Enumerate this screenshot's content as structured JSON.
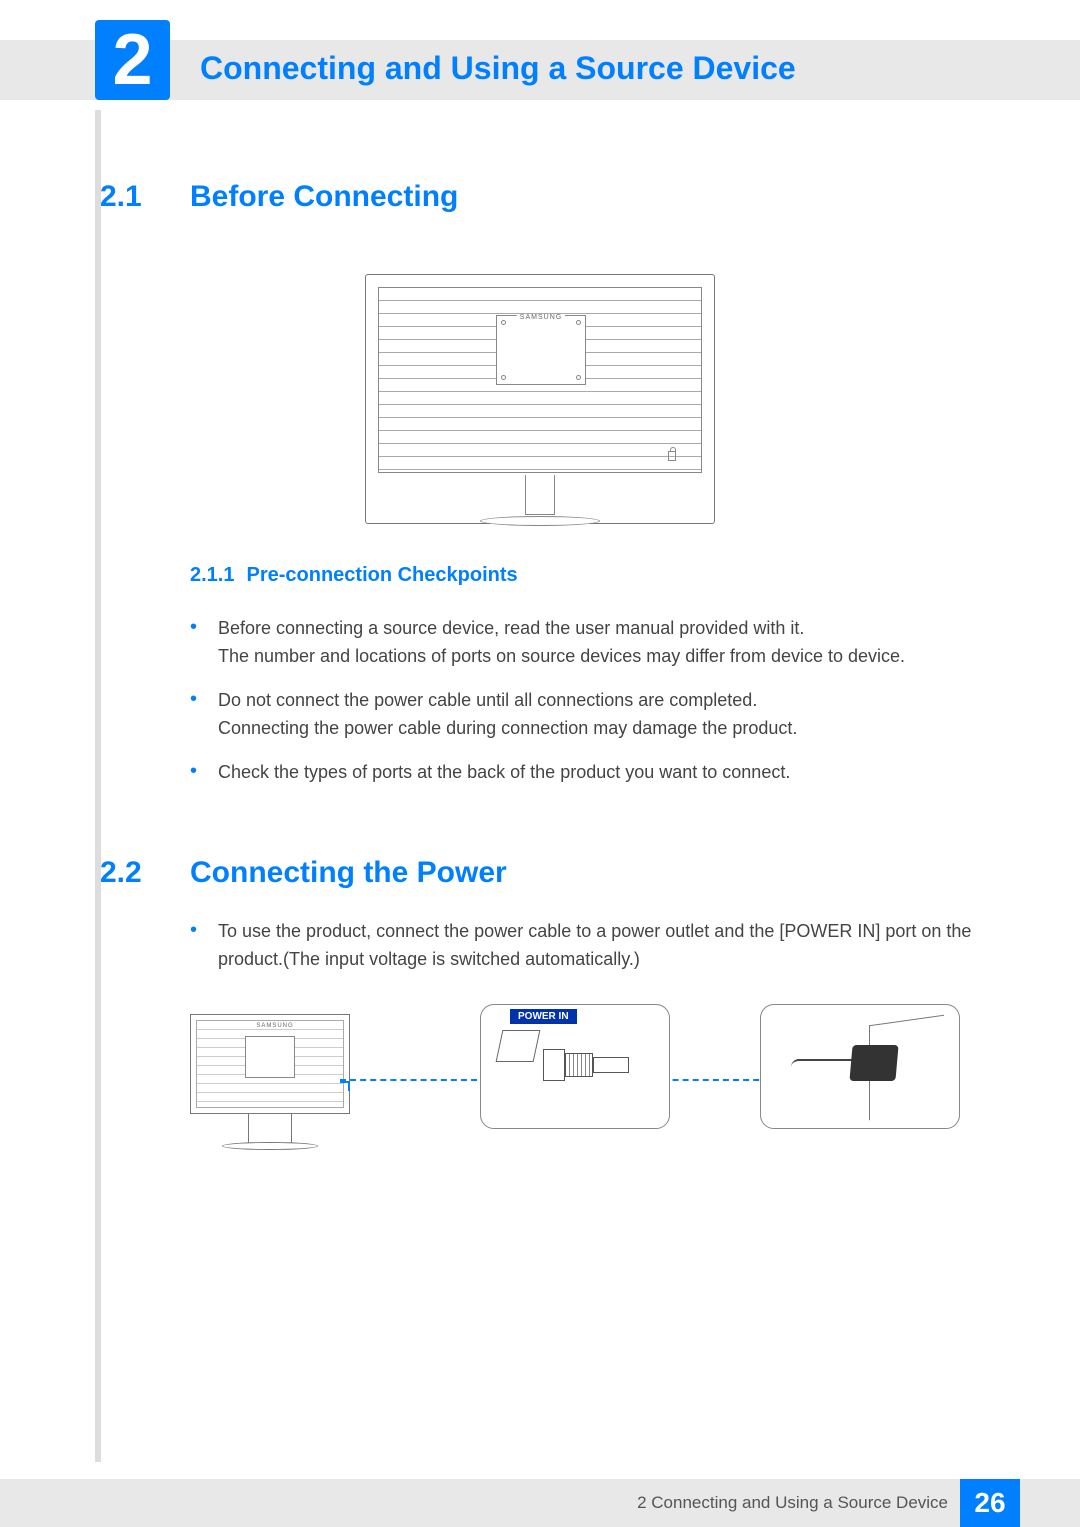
{
  "chapter": {
    "number": "2",
    "title": "Connecting and Using a Source Device"
  },
  "section_2_1": {
    "num": "2.1",
    "title": "Before Connecting",
    "illustration_brand": "SAMSUNG",
    "sub_2_1_1": {
      "num": "2.1.1",
      "title": "Pre-connection Checkpoints"
    },
    "bullets": [
      "Before connecting a source device, read the user manual provided with it.\nThe number and locations of ports on source devices may differ from device to device.",
      "Do not connect the power cable until all connections are completed.\nConnecting the power cable during connection may damage the product.",
      "Check the types of ports at the back of the product you want to connect."
    ]
  },
  "section_2_2": {
    "num": "2.2",
    "title": "Connecting the Power",
    "bullets": [
      "To use the product, connect the power cable to a power outlet and the [POWER IN] port on the product.(The input voltage is switched automatically.)"
    ],
    "power_in_label": "POWER IN",
    "illustration_brand": "SAMSUNG"
  },
  "footer": {
    "text": "2 Connecting and Using a Source Device",
    "page": "26"
  }
}
